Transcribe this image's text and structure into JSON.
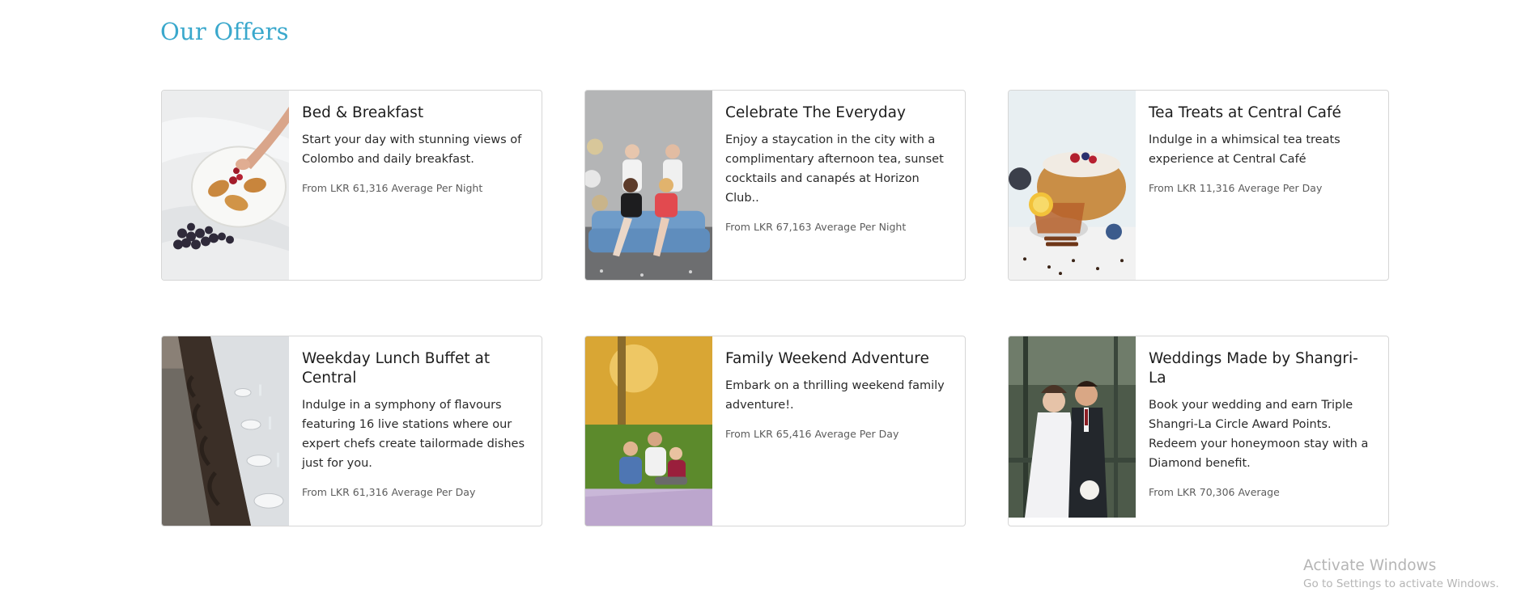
{
  "section": {
    "title": "Our Offers"
  },
  "offers": [
    {
      "title": "Bed & Breakfast",
      "description": "Start your day with stunning views of Colombo and daily breakfast.",
      "price": "From LKR 61,316 Average Per Night"
    },
    {
      "title": "Celebrate The Everyday",
      "description": "Enjoy a staycation in the city with a complimentary afternoon tea, sunset cocktails and canapés at Horizon Club..",
      "price": "From LKR 67,163 Average Per Night"
    },
    {
      "title": "Tea Treats at Central Café",
      "description": "Indulge in a whimsical tea treats experience at Central Café",
      "price": "From LKR 11,316 Average Per Day"
    },
    {
      "title": "Weekday Lunch Buffet at Central",
      "description": "Indulge in a symphony of flavours featuring 16 live stations where our expert chefs create tailormade dishes just for you.",
      "price": "From LKR 61,316 Average Per Day"
    },
    {
      "title": "Family Weekend Adventure",
      "description": "Embark on a thrilling weekend family adventure!.",
      "price": "From LKR 65,416 Average Per Day"
    },
    {
      "title": "Weddings Made by Shangri-La",
      "description": "Book your wedding and earn Triple Shangri-La Circle Award Points. Redeem your honeymoon stay with a Diamond benefit.",
      "price": "From LKR 70,306 Average"
    }
  ],
  "watermark": {
    "title": "Activate Windows",
    "subtitle": "Go to Settings to activate Windows."
  }
}
